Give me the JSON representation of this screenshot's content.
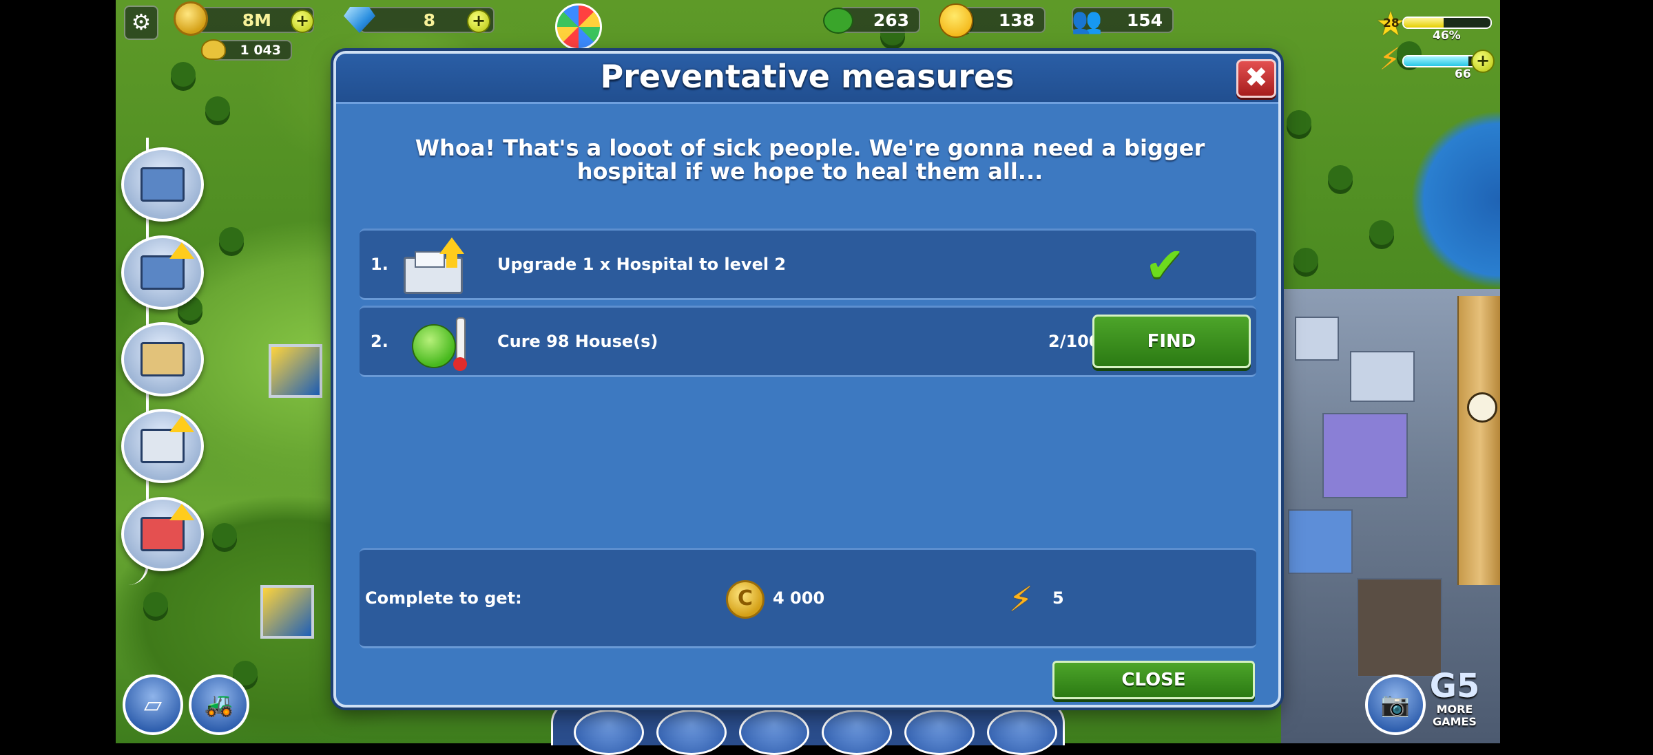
{
  "hud": {
    "coins": "8M",
    "gems": "8",
    "bonus": "1 043",
    "trees": "263",
    "happiness": "138",
    "population": "154",
    "level": "28",
    "xp_percent": "46%",
    "xp_fraction": 0.46,
    "energy": "66",
    "energy_fraction": 0.85
  },
  "dialog": {
    "title": "Preventative measures",
    "intro": "Whoa! That's a looot of sick people. We're gonna need a bigger hospital if we hope to heal them all...",
    "tasks": [
      {
        "num": "1.",
        "label": "Upgrade 1 x Hospital to level 2",
        "icon": "hospital-upgrade-icon",
        "status": "complete"
      },
      {
        "num": "2.",
        "label": "Cure 98 House(s)",
        "icon": "sick-face-icon",
        "progress": "2/100",
        "button": "FIND"
      }
    ],
    "reward_label": "Complete to get:",
    "reward_coins": "4 000",
    "reward_xp": "5",
    "close_label": "CLOSE"
  },
  "more_games": {
    "line1": "G5",
    "line2": "MORE",
    "line3": "GAMES"
  },
  "colors": {
    "dialog_bg": "#3d79c1",
    "row_bg": "#2c5b9c",
    "button_green": "#2b7a13",
    "close_red": "#a61d1d"
  }
}
